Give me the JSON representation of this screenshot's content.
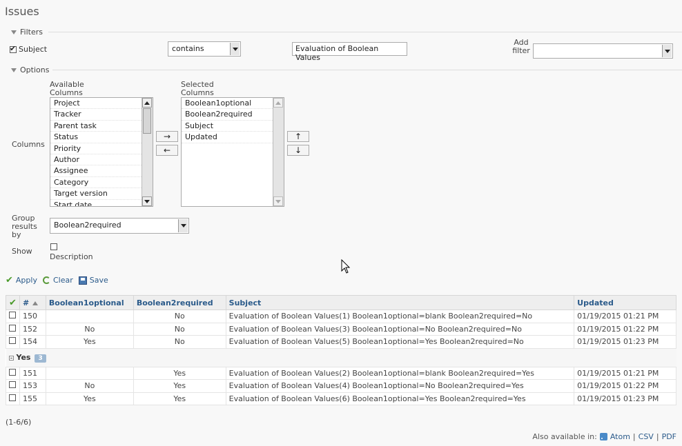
{
  "page": {
    "title": "Issues"
  },
  "filters": {
    "legend": "Filters",
    "subject_label": "Subject",
    "operator": "contains",
    "value": "Evaluation of Boolean Values",
    "add_filter_label": "Add filter",
    "add_filter_value": ""
  },
  "options": {
    "legend": "Options",
    "columns_label": "Columns",
    "available_label": "Available Columns",
    "selected_label": "Selected Columns",
    "available": [
      "Project",
      "Tracker",
      "Parent task",
      "Status",
      "Priority",
      "Author",
      "Assignee",
      "Category",
      "Target version",
      "Start date"
    ],
    "selected": [
      "Boolean1optional",
      "Boolean2required",
      "Subject",
      "Updated"
    ],
    "move_right": "→",
    "move_left": "←",
    "move_up": "↑",
    "move_down": "↓",
    "group_label": "Group results by",
    "group_value": "Boolean2required",
    "show_label": "Show",
    "description_label": "Description"
  },
  "actions": {
    "apply": "Apply",
    "clear": "Clear",
    "save": "Save"
  },
  "table": {
    "headers": {
      "id": "#",
      "b1": "Boolean1optional",
      "b2": "Boolean2required",
      "subject": "Subject",
      "updated": "Updated"
    },
    "group1": [
      {
        "id": "150",
        "b1": "",
        "b2": "No",
        "subject": "Evaluation of Boolean Values(1) Boolean1optional=blank Boolean2required=No",
        "updated": "01/19/2015 01:21 PM"
      },
      {
        "id": "152",
        "b1": "No",
        "b2": "No",
        "subject": "Evaluation of Boolean Values(3) Boolean1optional=No Boolean2required=No",
        "updated": "01/19/2015 01:22 PM"
      },
      {
        "id": "154",
        "b1": "Yes",
        "b2": "No",
        "subject": "Evaluation of Boolean Values(5) Boolean1optional=Yes Boolean2required=No",
        "updated": "01/19/2015 01:23 PM"
      }
    ],
    "group2": {
      "name": "Yes",
      "count": "3",
      "rows": [
        {
          "id": "151",
          "b1": "",
          "b2": "Yes",
          "subject": "Evaluation of Boolean Values(2) Boolean1optional=blank Boolean2required=Yes",
          "updated": "01/19/2015 01:21 PM"
        },
        {
          "id": "153",
          "b1": "No",
          "b2": "Yes",
          "subject": "Evaluation of Boolean Values(4) Boolean1optional=No Boolean2required=Yes",
          "updated": "01/19/2015 01:22 PM"
        },
        {
          "id": "155",
          "b1": "Yes",
          "b2": "Yes",
          "subject": "Evaluation of Boolean Values(6) Boolean1optional=Yes Boolean2required=Yes",
          "updated": "01/19/2015 01:23 PM"
        }
      ]
    }
  },
  "pagination": "(1-6/6)",
  "formats": {
    "label": "Also available in:",
    "atom": "Atom",
    "csv": "CSV",
    "pdf": "PDF"
  }
}
